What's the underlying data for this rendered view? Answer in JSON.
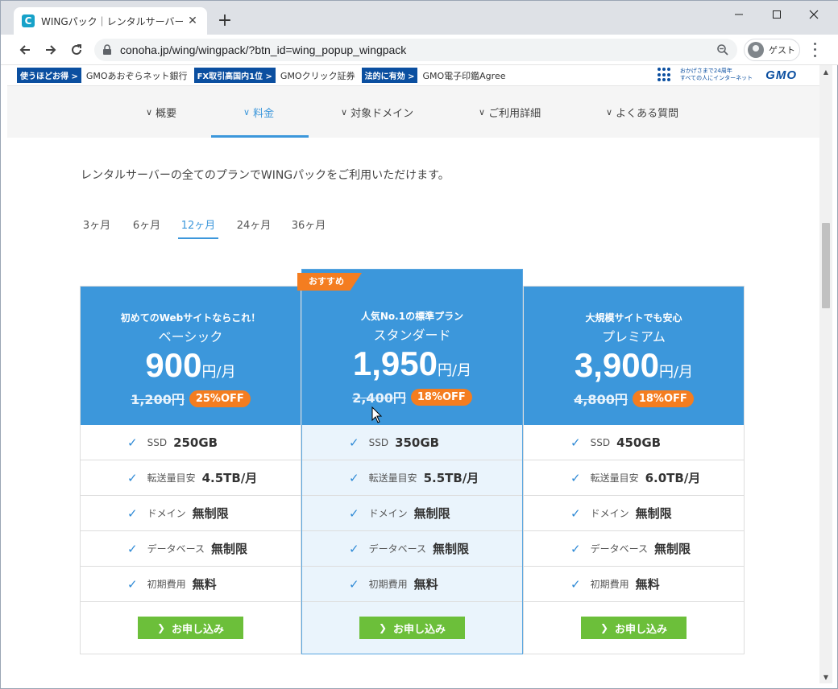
{
  "browser": {
    "tab_title": "WINGパック｜レンタルサーバーならCo",
    "new_tab": "+",
    "url": "conoha.jp/wing/wingpack/?btn_id=wing_popup_wingpack",
    "profile_label": "ゲスト"
  },
  "gmo_bar": {
    "items": [
      {
        "badge": "使うほどお得 >",
        "service": "GMOあおぞらネット銀行"
      },
      {
        "badge": "FX取引高国内1位 >",
        "service": "GMOクリック証券"
      },
      {
        "badge": "法的に有効 >",
        "service": "GMO電子印鑑Agree"
      }
    ],
    "anniversary_line1": "おかげさまで24周年",
    "anniversary_line2": "すべての人にインターネット",
    "logo": "GMO"
  },
  "subnav": {
    "items": [
      {
        "label": "概要",
        "active": false
      },
      {
        "label": "料金",
        "active": true
      },
      {
        "label": "対象ドメイン",
        "active": false
      },
      {
        "label": "ご利用詳細",
        "active": false
      },
      {
        "label": "よくある質問",
        "active": false
      }
    ]
  },
  "intro_text": "レンタルサーバーの全てのプランでWINGパックをご利用いただけます。",
  "periods": [
    {
      "label": "3ヶ月",
      "active": false
    },
    {
      "label": "6ヶ月",
      "active": false
    },
    {
      "label": "12ヶ月",
      "active": true
    },
    {
      "label": "24ヶ月",
      "active": false
    },
    {
      "label": "36ヶ月",
      "active": false
    }
  ],
  "plans": [
    {
      "tagline": "初めてのWebサイトならこれ！",
      "name": "ベーシック",
      "price": "900",
      "unit": "円/月",
      "old_price": "1,200円",
      "discount": "25%OFF",
      "featured": false,
      "features": [
        {
          "label": "SSD",
          "value": "250GB"
        },
        {
          "label": "転送量目安",
          "value": "4.5TB/月"
        },
        {
          "label": "ドメイン",
          "value": "無制限"
        },
        {
          "label": "データベース",
          "value": "無制限"
        },
        {
          "label": "初期費用",
          "value": "無料"
        }
      ],
      "cta": "お申し込み"
    },
    {
      "tagline": "人気No.1の標準プラン",
      "name": "スタンダード",
      "price": "1,950",
      "unit": "円/月",
      "old_price": "2,400円",
      "discount": "18%OFF",
      "featured": true,
      "ribbon": "おすすめ",
      "features": [
        {
          "label": "SSD",
          "value": "350GB"
        },
        {
          "label": "転送量目安",
          "value": "5.5TB/月"
        },
        {
          "label": "ドメイン",
          "value": "無制限"
        },
        {
          "label": "データベース",
          "value": "無制限"
        },
        {
          "label": "初期費用",
          "value": "無料"
        }
      ],
      "cta": "お申し込み"
    },
    {
      "tagline": "大規模サイトでも安心",
      "name": "プレミアム",
      "price": "3,900",
      "unit": "円/月",
      "old_price": "4,800円",
      "discount": "18%OFF",
      "featured": false,
      "features": [
        {
          "label": "SSD",
          "value": "450GB"
        },
        {
          "label": "転送量目安",
          "value": "6.0TB/月"
        },
        {
          "label": "ドメイン",
          "value": "無制限"
        },
        {
          "label": "データベース",
          "value": "無制限"
        },
        {
          "label": "初期費用",
          "value": "無料"
        }
      ],
      "cta": "お申し込み"
    }
  ],
  "colors": {
    "accent": "#3c97db",
    "discount": "#f47d20",
    "cta": "#6cbf3a",
    "featured_body": "#eaf4fc"
  }
}
